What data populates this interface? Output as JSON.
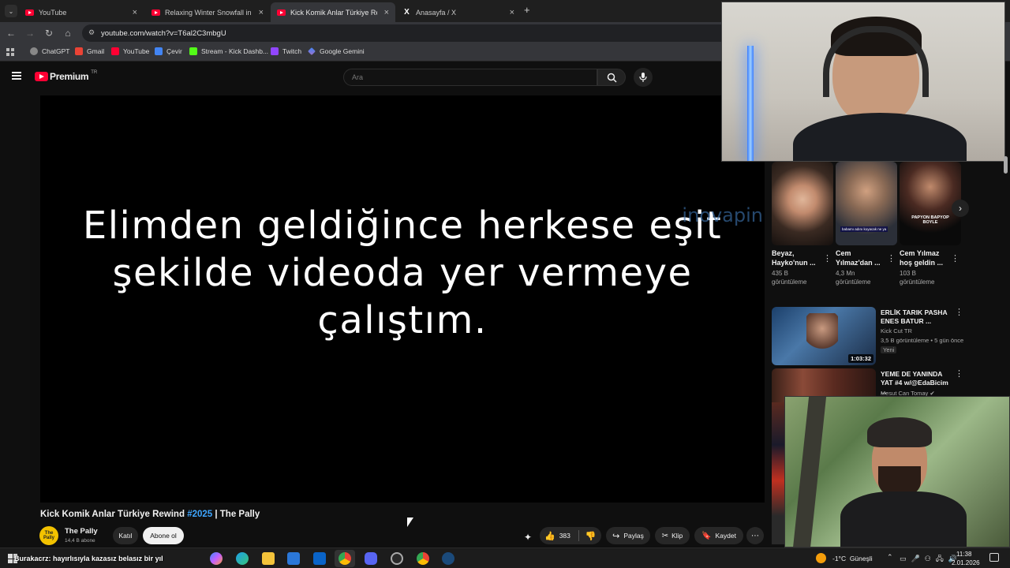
{
  "tabs": [
    {
      "title": "YouTube"
    },
    {
      "title": "Relaxing Winter Snowfall in Sw"
    },
    {
      "title": "Kick Komik Anlar Türkiye Rewin"
    },
    {
      "title": "Anasayfa / X"
    }
  ],
  "omnibox": {
    "url": "youtube.com/watch?v=T6al2C3mbgU"
  },
  "bookmarks": [
    "ChatGPT",
    "Gmail",
    "YouTube",
    "Çevir",
    "Stream - Kick Dashb...",
    "Twitch",
    "Google Gemini"
  ],
  "header": {
    "logo": "Premium",
    "logo_sup": "TR",
    "search_placeholder": "Ara"
  },
  "video": {
    "caption_lines": [
      "Elimden geldiğince herkese eşit",
      "şekilde videoda yer vermeye",
      "çalıştım."
    ],
    "watermark": "inovapin"
  },
  "title": {
    "prefix": "Kick Komik Anlar Türkiye Rewind ",
    "hashtag": "#2025",
    "suffix": " | The Pally"
  },
  "channel": {
    "name": "The Pally",
    "subs": "14,4 B abone",
    "avatar_text": "The Pally",
    "join": "Katıl",
    "subscribe": "Abone ol"
  },
  "actions": {
    "likes": "383",
    "share": "Paylaş",
    "clip": "Klip",
    "save": "Kaydet"
  },
  "shorts": [
    {
      "title": "Beyaz, Hayko'nun ...",
      "views": "435 B görüntüleme"
    },
    {
      "title": "Cem Yılmaz'dan ...",
      "views": "4,3 Mn görüntüleme",
      "overlay": "babamı adını koyacak ne ya"
    },
    {
      "title": "Cem Yılmaz hoş geldin ...",
      "views": "103 B görüntüleme",
      "overlay": "PAPYON BAPYOP BOYLE"
    }
  ],
  "videos": [
    {
      "title": "ERLİK TARIK PASHA ENES BATUR ...",
      "channel": "Kick Cut TR",
      "meta": "3,5 B görüntüleme • 5 gün önce",
      "badge": "Yeni",
      "duration": "1:03:32"
    },
    {
      "title": "YEME DE YANINDA YAT #4 w/@EdaBicim ...",
      "channel": "Mesut Can Tomay"
    }
  ],
  "taskbar": {
    "ticker": "Burakacrz: hayırlısıyla kazasız belasız bir yıl",
    "weather": "-1°C  Güneşli",
    "time": "11:38",
    "date": "2.01.2026"
  }
}
